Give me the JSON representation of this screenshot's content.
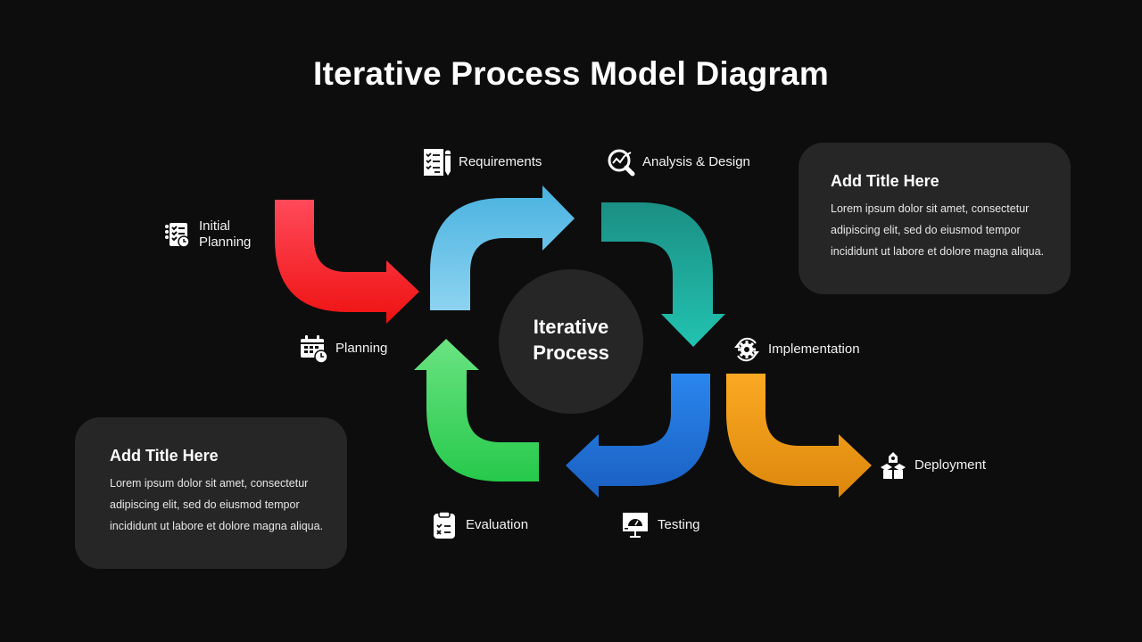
{
  "title": "Iterative Process Model Diagram",
  "center": {
    "line1": "Iterative",
    "line2": "Process"
  },
  "colors": {
    "background": "#0d0d0d",
    "card": "#262626",
    "center_circle": "#262626",
    "red": [
      "#ff4a5a",
      "#ee1111"
    ],
    "light_blue": [
      "#48b2e0",
      "#8dd3f0"
    ],
    "teal": [
      "#1b8f84",
      "#22c2b0"
    ],
    "blue": [
      "#2a86ee",
      "#1a5fc0"
    ],
    "green": [
      "#6be382",
      "#26c94b"
    ],
    "orange": [
      "#fba923",
      "#dc870c"
    ]
  },
  "steps": [
    {
      "id": "initial-planning",
      "label_line1": "Initial",
      "label_line2": "Planning",
      "icon": "checklist-clock-icon"
    },
    {
      "id": "planning",
      "label": "Planning",
      "icon": "calendar-clock-icon"
    },
    {
      "id": "requirements",
      "label": "Requirements",
      "icon": "checklist-pencil-icon"
    },
    {
      "id": "analysis-design",
      "label": "Analysis & Design",
      "icon": "chart-magnifier-icon"
    },
    {
      "id": "implementation",
      "label": "Implementation",
      "icon": "gear-cycle-icon"
    },
    {
      "id": "testing",
      "label": "Testing",
      "icon": "monitor-gauge-icon"
    },
    {
      "id": "evaluation",
      "label": "Evaluation",
      "icon": "clipboard-checklist-icon"
    },
    {
      "id": "deployment",
      "label": "Deployment",
      "icon": "box-rocket-icon"
    }
  ],
  "cards": [
    {
      "title": "Add Title Here",
      "lines": [
        "Lorem ipsum dolor sit amet, consectetur",
        "adipiscing elit, sed do eiusmod  tempor",
        "incididunt ut labore et dolore magna aliqua."
      ]
    },
    {
      "title": "Add Title Here",
      "lines": [
        "Lorem ipsum dolor sit amet, consectetur",
        "adipiscing elit, sed do eiusmod  tempor",
        "incididunt ut labore et dolore magna aliqua."
      ]
    }
  ]
}
